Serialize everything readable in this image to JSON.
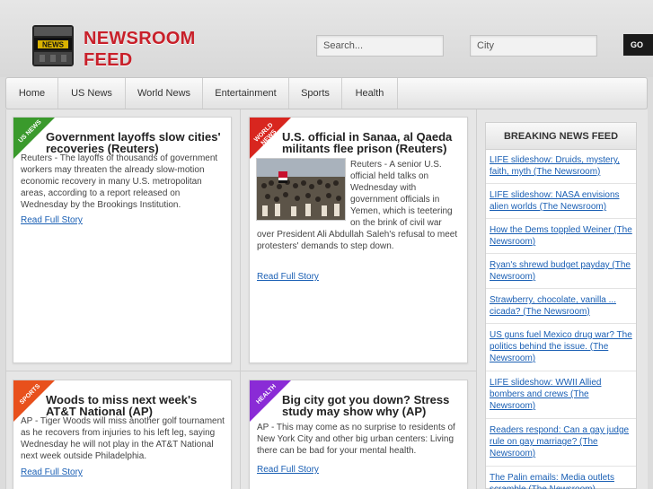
{
  "header": {
    "logo_line1": "NEWSROOM",
    "logo_line2": "FEED",
    "logo_icon_text": "NEWS",
    "search_placeholder": "Search...",
    "city_placeholder": "City",
    "go_label": "GO"
  },
  "nav": {
    "items": [
      "Home",
      "US News",
      "World News",
      "Entertainment",
      "Sports",
      "Health"
    ]
  },
  "articles": [
    {
      "category": "US NEWS",
      "category_color": "#3a9a2c",
      "title": "Government layoffs slow cities' recoveries (Reuters)",
      "body": "Reuters - The layoffs of thousands of government workers may threaten the already slow-motion economic recovery in many U.S. metropolitan areas, according to a report released on Wednesday by the Brookings Institution.",
      "link": "Read Full Story"
    },
    {
      "category": "WORLD NEWS",
      "category_color": "#d8261f",
      "title": "U.S. official in Sanaa, al Qaeda militants flee prison (Reuters)",
      "body_side": "Reuters - A senior U.S. official held talks on Wednesday with government officials in Yemen, which is teetering on the brink of civil war",
      "body_full": "over President Ali Abdullah Saleh's refusal to meet protesters' demands to step down.",
      "link": "Read Full Story"
    },
    {
      "category": "SPORTS",
      "category_color": "#e8501c",
      "title": "Woods to miss next week's AT&T National (AP)",
      "body": "AP - Tiger Woods will miss another golf tournament as he recovers from injuries to his left leg, saying Wednesday he will not play in the AT&T National next week outside Philadelphia.",
      "link": "Read Full Story"
    },
    {
      "category": "HEALTH",
      "category_color": "#8a2bd6",
      "title": "Big city got you down? Stress study may show why (AP)",
      "body": "AP - This may come as no surprise to residents of New York City and other big urban centers: Living there can be bad for your mental health.",
      "link": "Read Full Story"
    }
  ],
  "sidebar": {
    "heading": "BREAKING NEWS FEED",
    "items": [
      "LIFE slideshow: Druids, mystery, faith, myth (The Newsroom)",
      "LIFE slideshow: NASA envisions alien worlds (The Newsroom)",
      "How the Dems toppled Weiner (The Newsroom)",
      "Ryan's shrewd budget payday (The Newsroom)",
      "Strawberry, chocolate, vanilla ... cicada? (The Newsroom)",
      "US guns fuel Mexico drug war? The politics behind the issue. (The Newsroom)",
      "LIFE slideshow: WWII Allied bombers and crews (The Newsroom)",
      "Readers respond: Can a gay judge rule on gay marriage? (The Newsroom)",
      "The Palin emails: Media outlets scramble (The Newsroom)"
    ]
  }
}
